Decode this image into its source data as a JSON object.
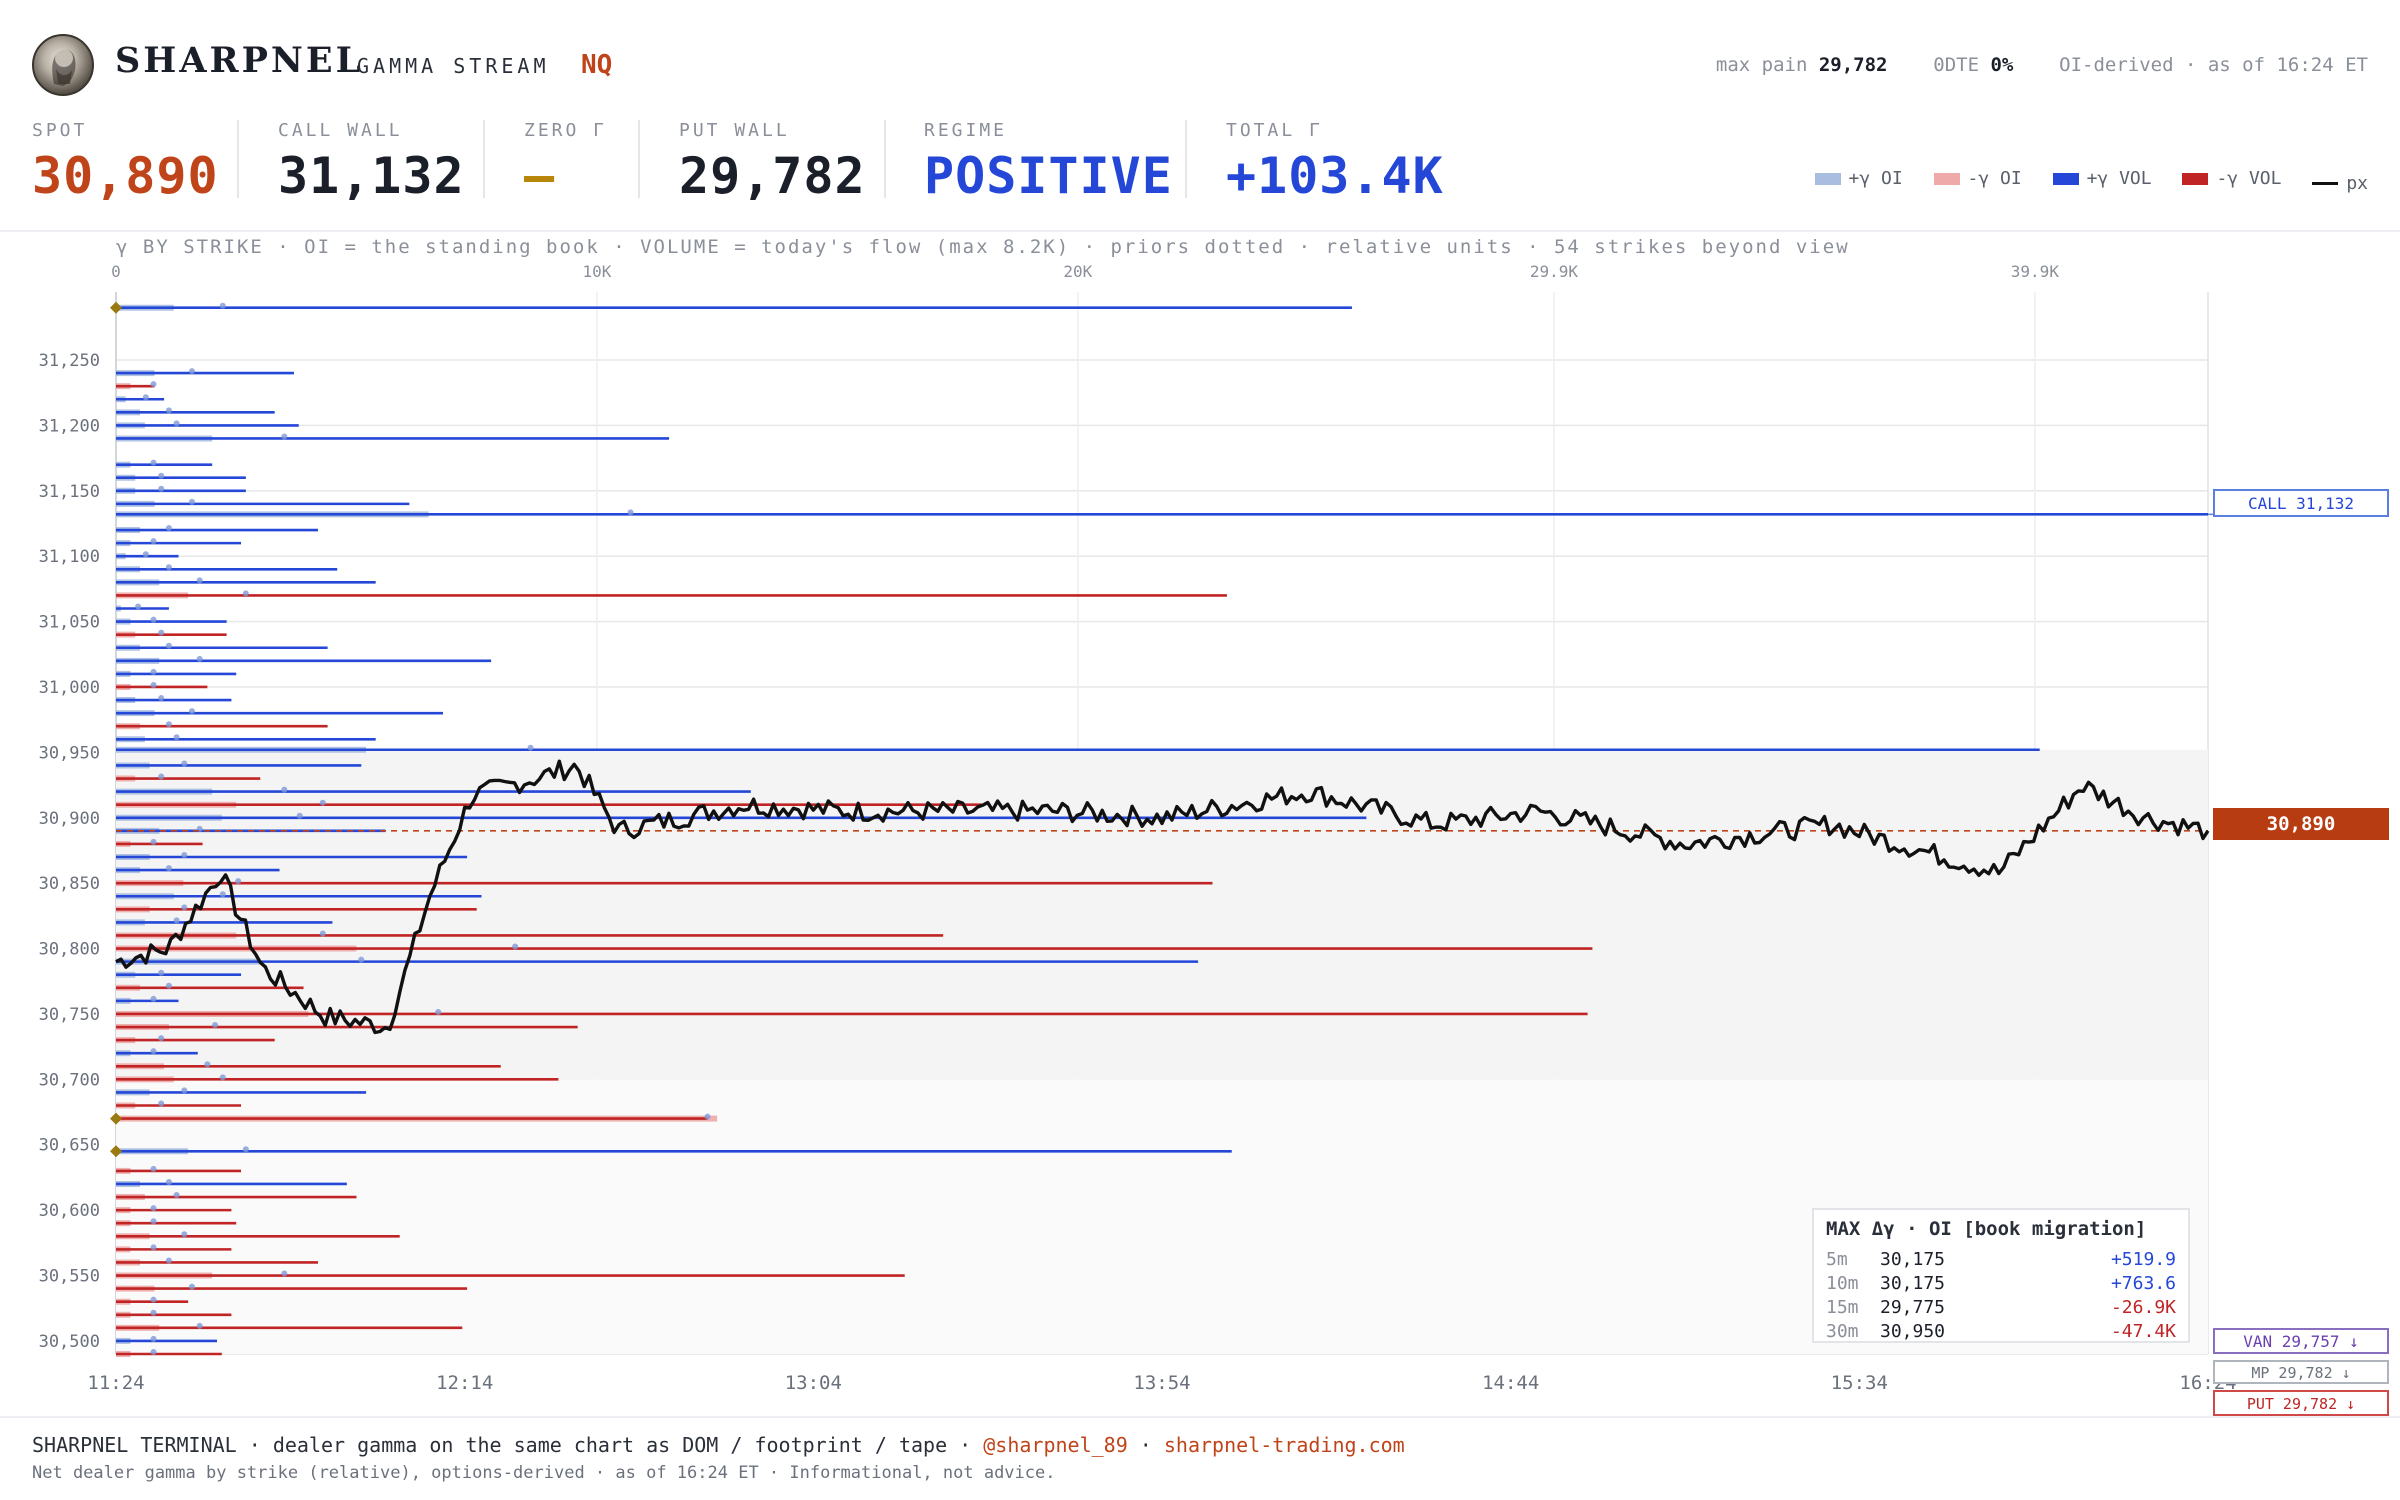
{
  "brand": {
    "name": "SHARPNEL",
    "subtitle": "GAMMA STREAM",
    "symbol": "NQ"
  },
  "meta": {
    "max_pain_label": "max pain",
    "max_pain": "29,782",
    "dte_label": "0DTE",
    "dte": "0%",
    "source": "OI-derived · as of 16:24 ET"
  },
  "stats": [
    {
      "label": "SPOT",
      "value": "30,890",
      "color": "#c0441a"
    },
    {
      "label": "CALL WALL",
      "value": "31,132",
      "color": "#1b1f2a"
    },
    {
      "label": "ZERO Γ",
      "value": "—",
      "color": "#b8860b"
    },
    {
      "label": "PUT WALL",
      "value": "29,782",
      "color": "#1b1f2a"
    },
    {
      "label": "REGIME",
      "value": "POSITIVE",
      "color": "#2447d8"
    },
    {
      "label": "TOTAL Γ",
      "value": "+103.4K",
      "color": "#2447d8"
    }
  ],
  "legend": [
    {
      "label": "+γ OI",
      "color": "#a8bde0",
      "icon": "swatch"
    },
    {
      "label": "-γ OI",
      "color": "#eeaaa8",
      "icon": "swatch"
    },
    {
      "label": "+γ VOL",
      "color": "#2447d8",
      "icon": "swatch"
    },
    {
      "label": "-γ VOL",
      "color": "#c02424",
      "icon": "swatch"
    },
    {
      "label": "px",
      "color": "#111111",
      "icon": "line"
    }
  ],
  "chart_caption": "γ BY STRIKE · OI = the standing book · VOLUME = today's flow (max 8.2K) · priors dotted · relative units · 54 strikes beyond view",
  "chart_data": {
    "type": "bar",
    "top_axis": {
      "ticks": [
        "0",
        "10K",
        "20K",
        "29.9K",
        "39.9K"
      ],
      "values": [
        0,
        10000,
        20000,
        29900,
        39900
      ],
      "max": 43500
    },
    "y_axis": {
      "min": 30490,
      "max": 31302,
      "ticks": [
        "31,250",
        "31,200",
        "31,150",
        "31,100",
        "31,050",
        "31,000",
        "30,950",
        "30,900",
        "30,850",
        "30,800",
        "30,750",
        "30,700",
        "30,650",
        "30,600",
        "30,550",
        "30,500"
      ],
      "tick_values": [
        31250,
        31200,
        31150,
        31100,
        31050,
        31000,
        30950,
        30900,
        30850,
        30800,
        30750,
        30700,
        30650,
        30600,
        30550,
        30500
      ]
    },
    "x_axis": {
      "ticks": [
        "11:24",
        "12:14",
        "13:04",
        "13:54",
        "14:44",
        "15:34",
        "16:24"
      ]
    },
    "bars": [
      {
        "strike": 31290,
        "sign": "pos",
        "value": 25700,
        "oi": 1200
      },
      {
        "strike": 31240,
        "sign": "pos",
        "value": 3700,
        "oi": 800
      },
      {
        "strike": 31230,
        "sign": "neg",
        "value": 800,
        "oi": 300
      },
      {
        "strike": 31220,
        "sign": "pos",
        "value": 1000,
        "oi": 200
      },
      {
        "strike": 31210,
        "sign": "pos",
        "value": 3300,
        "oi": 500
      },
      {
        "strike": 31200,
        "sign": "pos",
        "value": 3800,
        "oi": 600
      },
      {
        "strike": 31190,
        "sign": "pos",
        "value": 11500,
        "oi": 2000
      },
      {
        "strike": 31170,
        "sign": "pos",
        "value": 2000,
        "oi": 300
      },
      {
        "strike": 31160,
        "sign": "pos",
        "value": 2700,
        "oi": 400
      },
      {
        "strike": 31150,
        "sign": "pos",
        "value": 2700,
        "oi": 400
      },
      {
        "strike": 31140,
        "sign": "pos",
        "value": 6100,
        "oi": 800
      },
      {
        "strike": 31132,
        "sign": "pos",
        "value": 43500,
        "oi": 6500
      },
      {
        "strike": 31120,
        "sign": "pos",
        "value": 4200,
        "oi": 500
      },
      {
        "strike": 31110,
        "sign": "pos",
        "value": 2600,
        "oi": 300
      },
      {
        "strike": 31100,
        "sign": "pos",
        "value": 1300,
        "oi": 200
      },
      {
        "strike": 31090,
        "sign": "pos",
        "value": 4600,
        "oi": 500
      },
      {
        "strike": 31080,
        "sign": "pos",
        "value": 5400,
        "oi": 900
      },
      {
        "strike": 31070,
        "sign": "neg",
        "value": 23100,
        "oi": 1500
      },
      {
        "strike": 31060,
        "sign": "pos",
        "value": 1100,
        "oi": 100
      },
      {
        "strike": 31050,
        "sign": "pos",
        "value": 2300,
        "oi": 300
      },
      {
        "strike": 31040,
        "sign": "neg",
        "value": 2300,
        "oi": 400
      },
      {
        "strike": 31030,
        "sign": "pos",
        "value": 4400,
        "oi": 500
      },
      {
        "strike": 31020,
        "sign": "pos",
        "value": 7800,
        "oi": 900
      },
      {
        "strike": 31010,
        "sign": "pos",
        "value": 2500,
        "oi": 300
      },
      {
        "strike": 31000,
        "sign": "neg",
        "value": 1900,
        "oi": 300
      },
      {
        "strike": 30990,
        "sign": "pos",
        "value": 2400,
        "oi": 400
      },
      {
        "strike": 30980,
        "sign": "pos",
        "value": 6800,
        "oi": 800
      },
      {
        "strike": 30970,
        "sign": "neg",
        "value": 4400,
        "oi": 500
      },
      {
        "strike": 30960,
        "sign": "pos",
        "value": 5400,
        "oi": 600
      },
      {
        "strike": 30952,
        "sign": "pos",
        "value": 40000,
        "oi": 5200
      },
      {
        "strike": 30940,
        "sign": "pos",
        "value": 5100,
        "oi": 700
      },
      {
        "strike": 30930,
        "sign": "neg",
        "value": 3000,
        "oi": 400
      },
      {
        "strike": 30920,
        "sign": "pos",
        "value": 13200,
        "oi": 2000
      },
      {
        "strike": 30910,
        "sign": "neg",
        "value": 18000,
        "oi": 2500
      },
      {
        "strike": 30900,
        "sign": "pos",
        "value": 26000,
        "oi": 2200
      },
      {
        "strike": 30890,
        "sign": "pos",
        "value": 5600,
        "oi": 900
      },
      {
        "strike": 30880,
        "sign": "neg",
        "value": 1800,
        "oi": 300
      },
      {
        "strike": 30870,
        "sign": "pos",
        "value": 7300,
        "oi": 700
      },
      {
        "strike": 30860,
        "sign": "pos",
        "value": 3400,
        "oi": 500
      },
      {
        "strike": 30850,
        "sign": "neg",
        "value": 22800,
        "oi": 1400
      },
      {
        "strike": 30840,
        "sign": "pos",
        "value": 7600,
        "oi": 1200
      },
      {
        "strike": 30830,
        "sign": "neg",
        "value": 7500,
        "oi": 700
      },
      {
        "strike": 30820,
        "sign": "pos",
        "value": 4500,
        "oi": 600
      },
      {
        "strike": 30810,
        "sign": "neg",
        "value": 17200,
        "oi": 2500
      },
      {
        "strike": 30800,
        "sign": "neg",
        "value": 30700,
        "oi": 5000
      },
      {
        "strike": 30790,
        "sign": "pos",
        "value": 22500,
        "oi": 3000
      },
      {
        "strike": 30780,
        "sign": "pos",
        "value": 2600,
        "oi": 400
      },
      {
        "strike": 30770,
        "sign": "neg",
        "value": 3900,
        "oi": 500
      },
      {
        "strike": 30760,
        "sign": "pos",
        "value": 1300,
        "oi": 300
      },
      {
        "strike": 30750,
        "sign": "neg",
        "value": 30600,
        "oi": 4000
      },
      {
        "strike": 30740,
        "sign": "neg",
        "value": 9600,
        "oi": 1100
      },
      {
        "strike": 30730,
        "sign": "neg",
        "value": 3300,
        "oi": 400
      },
      {
        "strike": 30720,
        "sign": "pos",
        "value": 1700,
        "oi": 300
      },
      {
        "strike": 30710,
        "sign": "neg",
        "value": 8000,
        "oi": 1000
      },
      {
        "strike": 30700,
        "sign": "neg",
        "value": 9200,
        "oi": 1200
      },
      {
        "strike": 30690,
        "sign": "pos",
        "value": 5200,
        "oi": 700
      },
      {
        "strike": 30680,
        "sign": "neg",
        "value": 2600,
        "oi": 400
      },
      {
        "strike": 30670,
        "sign": "neg",
        "value": 12300,
        "oi": 12500
      },
      {
        "strike": 30645,
        "sign": "pos",
        "value": 23200,
        "oi": 1500
      },
      {
        "strike": 30630,
        "sign": "neg",
        "value": 2600,
        "oi": 300
      },
      {
        "strike": 30620,
        "sign": "pos",
        "value": 4800,
        "oi": 500
      },
      {
        "strike": 30610,
        "sign": "neg",
        "value": 5000,
        "oi": 600
      },
      {
        "strike": 30600,
        "sign": "neg",
        "value": 2400,
        "oi": 300
      },
      {
        "strike": 30590,
        "sign": "neg",
        "value": 2500,
        "oi": 300
      },
      {
        "strike": 30580,
        "sign": "neg",
        "value": 5900,
        "oi": 700
      },
      {
        "strike": 30570,
        "sign": "neg",
        "value": 2400,
        "oi": 300
      },
      {
        "strike": 30560,
        "sign": "neg",
        "value": 4200,
        "oi": 500
      },
      {
        "strike": 30550,
        "sign": "neg",
        "value": 16400,
        "oi": 2000
      },
      {
        "strike": 30540,
        "sign": "neg",
        "value": 7300,
        "oi": 800
      },
      {
        "strike": 30530,
        "sign": "neg",
        "value": 1500,
        "oi": 300
      },
      {
        "strike": 30520,
        "sign": "neg",
        "value": 2400,
        "oi": 300
      },
      {
        "strike": 30510,
        "sign": "neg",
        "value": 7200,
        "oi": 900
      },
      {
        "strike": 30500,
        "sign": "pos",
        "value": 2100,
        "oi": 300
      },
      {
        "strike": 30490,
        "sign": "neg",
        "value": 2200,
        "oi": 300
      }
    ],
    "price_series": {
      "start": 30790,
      "end": 30890,
      "spot": 30890
    },
    "migration": {
      "title": "MAX Δγ · OI [book migration]",
      "rows": [
        {
          "window": "5m",
          "strike": "30,175",
          "delta": "+519.9",
          "color": "#2447d8"
        },
        {
          "window": "10m",
          "strike": "30,175",
          "delta": "+763.6",
          "color": "#2447d8"
        },
        {
          "window": "15m",
          "strike": "29,775",
          "delta": "-26.9K",
          "color": "#c02424"
        },
        {
          "window": "30m",
          "strike": "30,950",
          "delta": "-47.4K",
          "color": "#c02424"
        }
      ]
    },
    "tags": {
      "call_wall": "CALL 31,132",
      "spot": "30,890",
      "van": "VAN 29,757 ↓",
      "mp": "MP 29,782 ↓",
      "put": "PUT 29,782 ↓"
    }
  },
  "footer": {
    "line1_a": "SHARPNEL TERMINAL · dealer gamma on the same chart as DOM / footprint / tape ·",
    "handle": "@sharpnel_89",
    "dot": "·",
    "site": "sharpnel-trading.com",
    "line2": "Net dealer gamma by strike (relative), options-derived · as of 16:24 ET · Informational, not advice."
  }
}
